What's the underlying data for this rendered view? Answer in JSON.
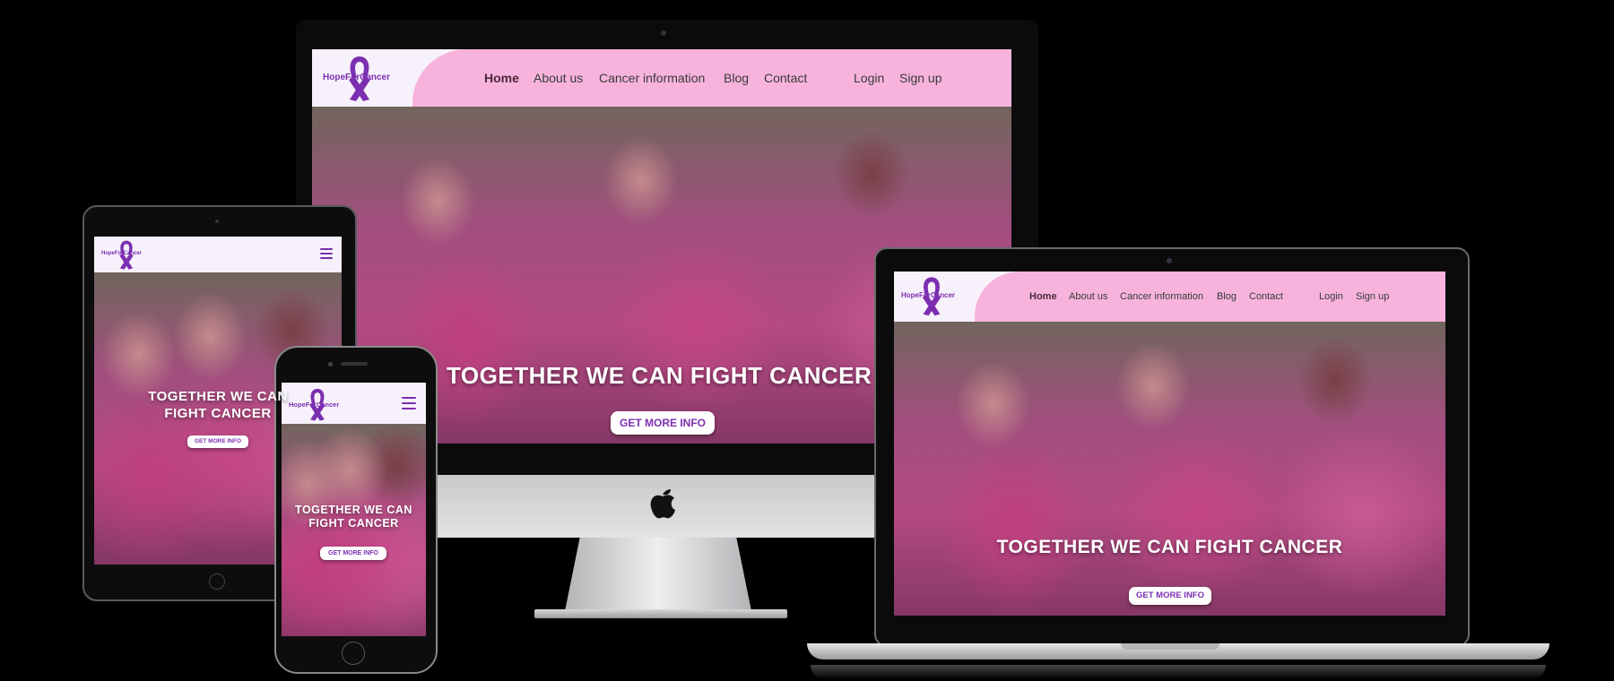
{
  "brand": {
    "name": "HopeForCancer",
    "purple": "#7b2fb0",
    "pink": "#f7b3dc",
    "lavender": "#f7f1fb"
  },
  "nav": {
    "home": "Home",
    "about": "About us",
    "cancer_info": "Cancer information",
    "blog": "Blog",
    "contact": "Contact",
    "login": "Login",
    "signup": "Sign up"
  },
  "hero": {
    "title": "TOGETHER WE CAN FIGHT CANCER",
    "title_line1": "TOGETHER WE CAN",
    "title_line2": "FIGHT CANCER",
    "button": "GET MORE INFO"
  },
  "icons": {
    "ribbon": "awareness-ribbon-logo",
    "menu": "hamburger-menu-icon",
    "apple": "apple-logo"
  }
}
